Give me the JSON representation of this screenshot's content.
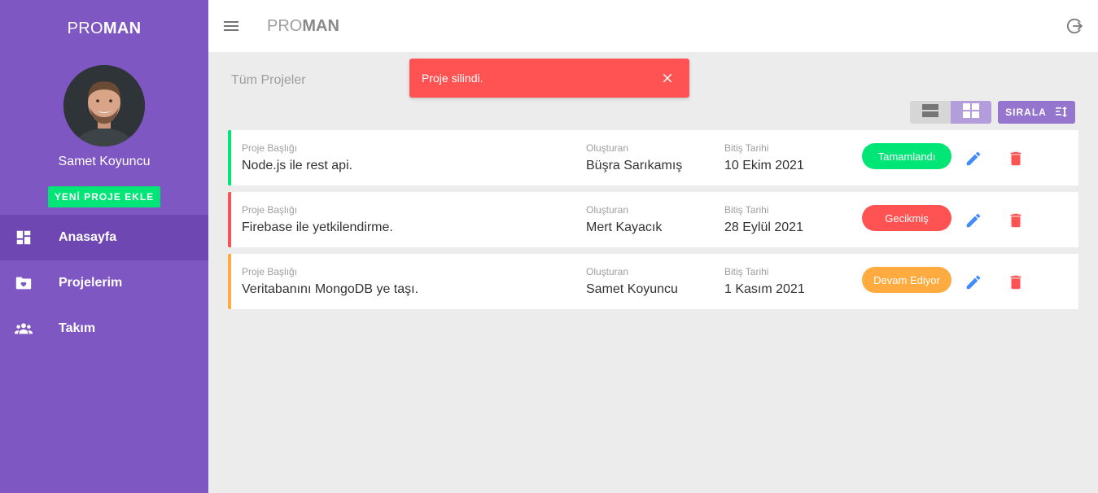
{
  "app": {
    "brand_light": "PRO",
    "brand_bold": "MAN"
  },
  "sidebar": {
    "user_name": "Samet Koyuncu",
    "add_button_label": "YENİ PROJE EKLE",
    "items": [
      {
        "label": "Anasayfa",
        "icon": "dashboard-icon",
        "active": true
      },
      {
        "label": "Projelerim",
        "icon": "folder-heart-icon",
        "active": false
      },
      {
        "label": "Takım",
        "icon": "team-icon",
        "active": false
      }
    ]
  },
  "topbar": {
    "title_light": "PRO",
    "title_bold": "MAN"
  },
  "main": {
    "heading": "Tüm Projeler",
    "sort_label": "SIRALA"
  },
  "toast": {
    "message": "Proje silindi.",
    "color": "#ff5252"
  },
  "labels": {
    "title": "Proje Başlığı",
    "owner": "Oluşturan",
    "due": "Bitiş Tarihi"
  },
  "projects": [
    {
      "title": "Node.js ile rest api.",
      "owner": "Büşra Sarıkamış",
      "due": "10 Ekim 2021",
      "status": "Tamamlandı",
      "color": "#00e676"
    },
    {
      "title": "Firebase ile yetkilendirme.",
      "owner": "Mert Kayacık",
      "due": "28 Eylül 2021",
      "status": "Gecikmiş",
      "color": "#ff5252"
    },
    {
      "title": "Veritabanını MongoDB ye taşı.",
      "owner": "Samet Koyuncu",
      "due": "1 Kasım 2021",
      "status": "Devam Ediyor",
      "color": "#ffab40"
    }
  ],
  "colors": {
    "sidebar": "#7e57c2",
    "accent": "#9575cd",
    "success": "#00e676",
    "danger": "#ff5252",
    "warning": "#ffab40",
    "edit": "#448aff"
  }
}
